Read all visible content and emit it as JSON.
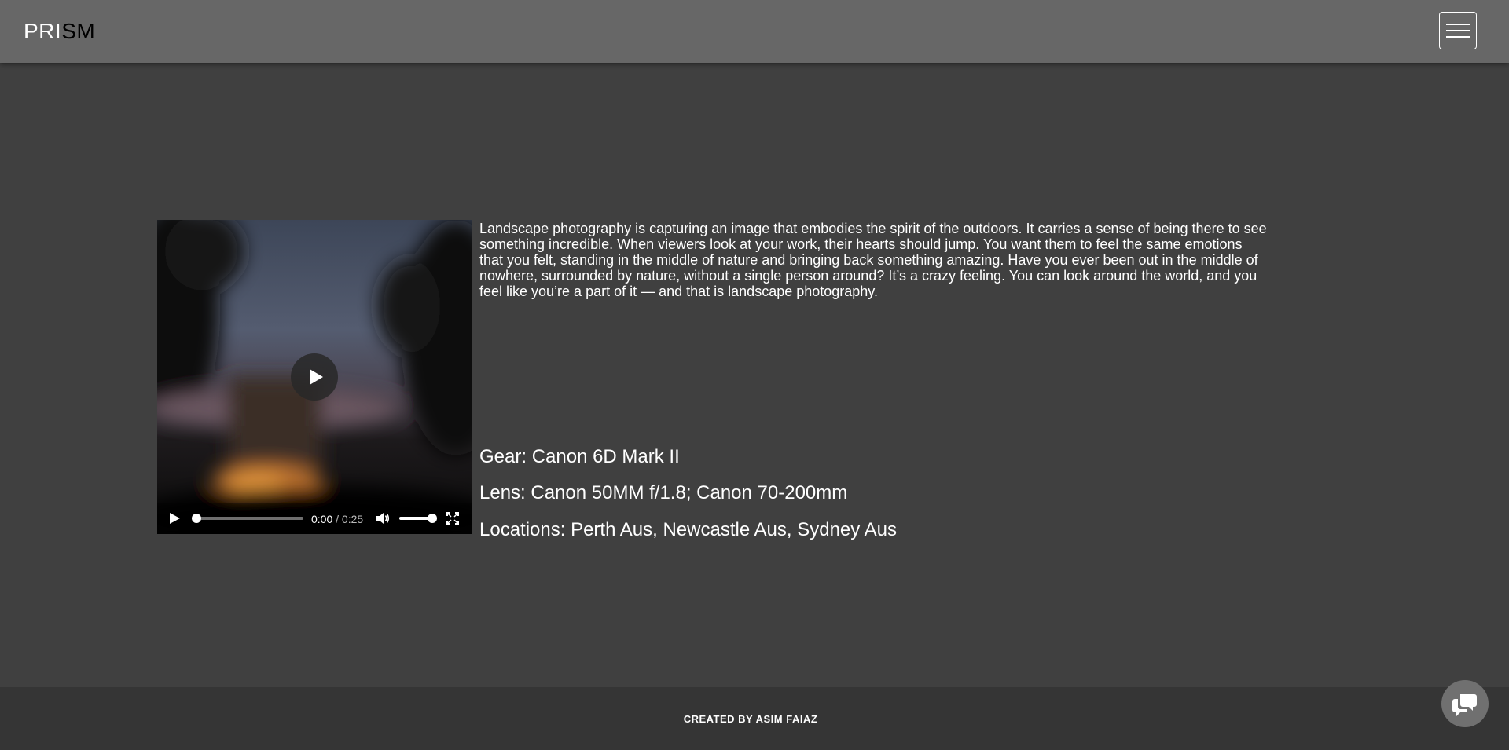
{
  "header": {
    "brand_part1": "PRI",
    "brand_part2": "SM",
    "menu_icon": "hamburger-menu-icon"
  },
  "video": {
    "current_time": "0:00",
    "separator": " / ",
    "duration": "0:25",
    "progress": 0,
    "volume": 1,
    "icons": [
      "play-icon",
      "volume-icon",
      "fullscreen-icon"
    ]
  },
  "content": {
    "description": "Landscape photography is capturing an image that embodies the spirit of the outdoors. It carries a sense of being there to see something incredible. When viewers look at your work, their hearts should jump. You want them to feel the same emotions that you felt, standing in the middle of nature and bringing back something amazing. Have you ever been out in the middle of nowhere, surrounded by nature, without a single person around? It’s a crazy feeling. You can look around the world, and you feel like you’re a part of it — and that is landscape photography.",
    "gear": "Gear: Canon 6D Mark II",
    "lens": "Lens: Canon 50MM f/1.8; Canon 70-200mm",
    "locations": "Locations: Perth Aus, Newcastle Aus, Sydney Aus"
  },
  "footer": {
    "credit": "CREATED BY ASIM FAIAZ"
  },
  "chat": {
    "icon": "chat-bubbles-icon"
  },
  "colors": {
    "page_background": "#404040",
    "header_background": "#676767",
    "footer_background": "#353535"
  }
}
